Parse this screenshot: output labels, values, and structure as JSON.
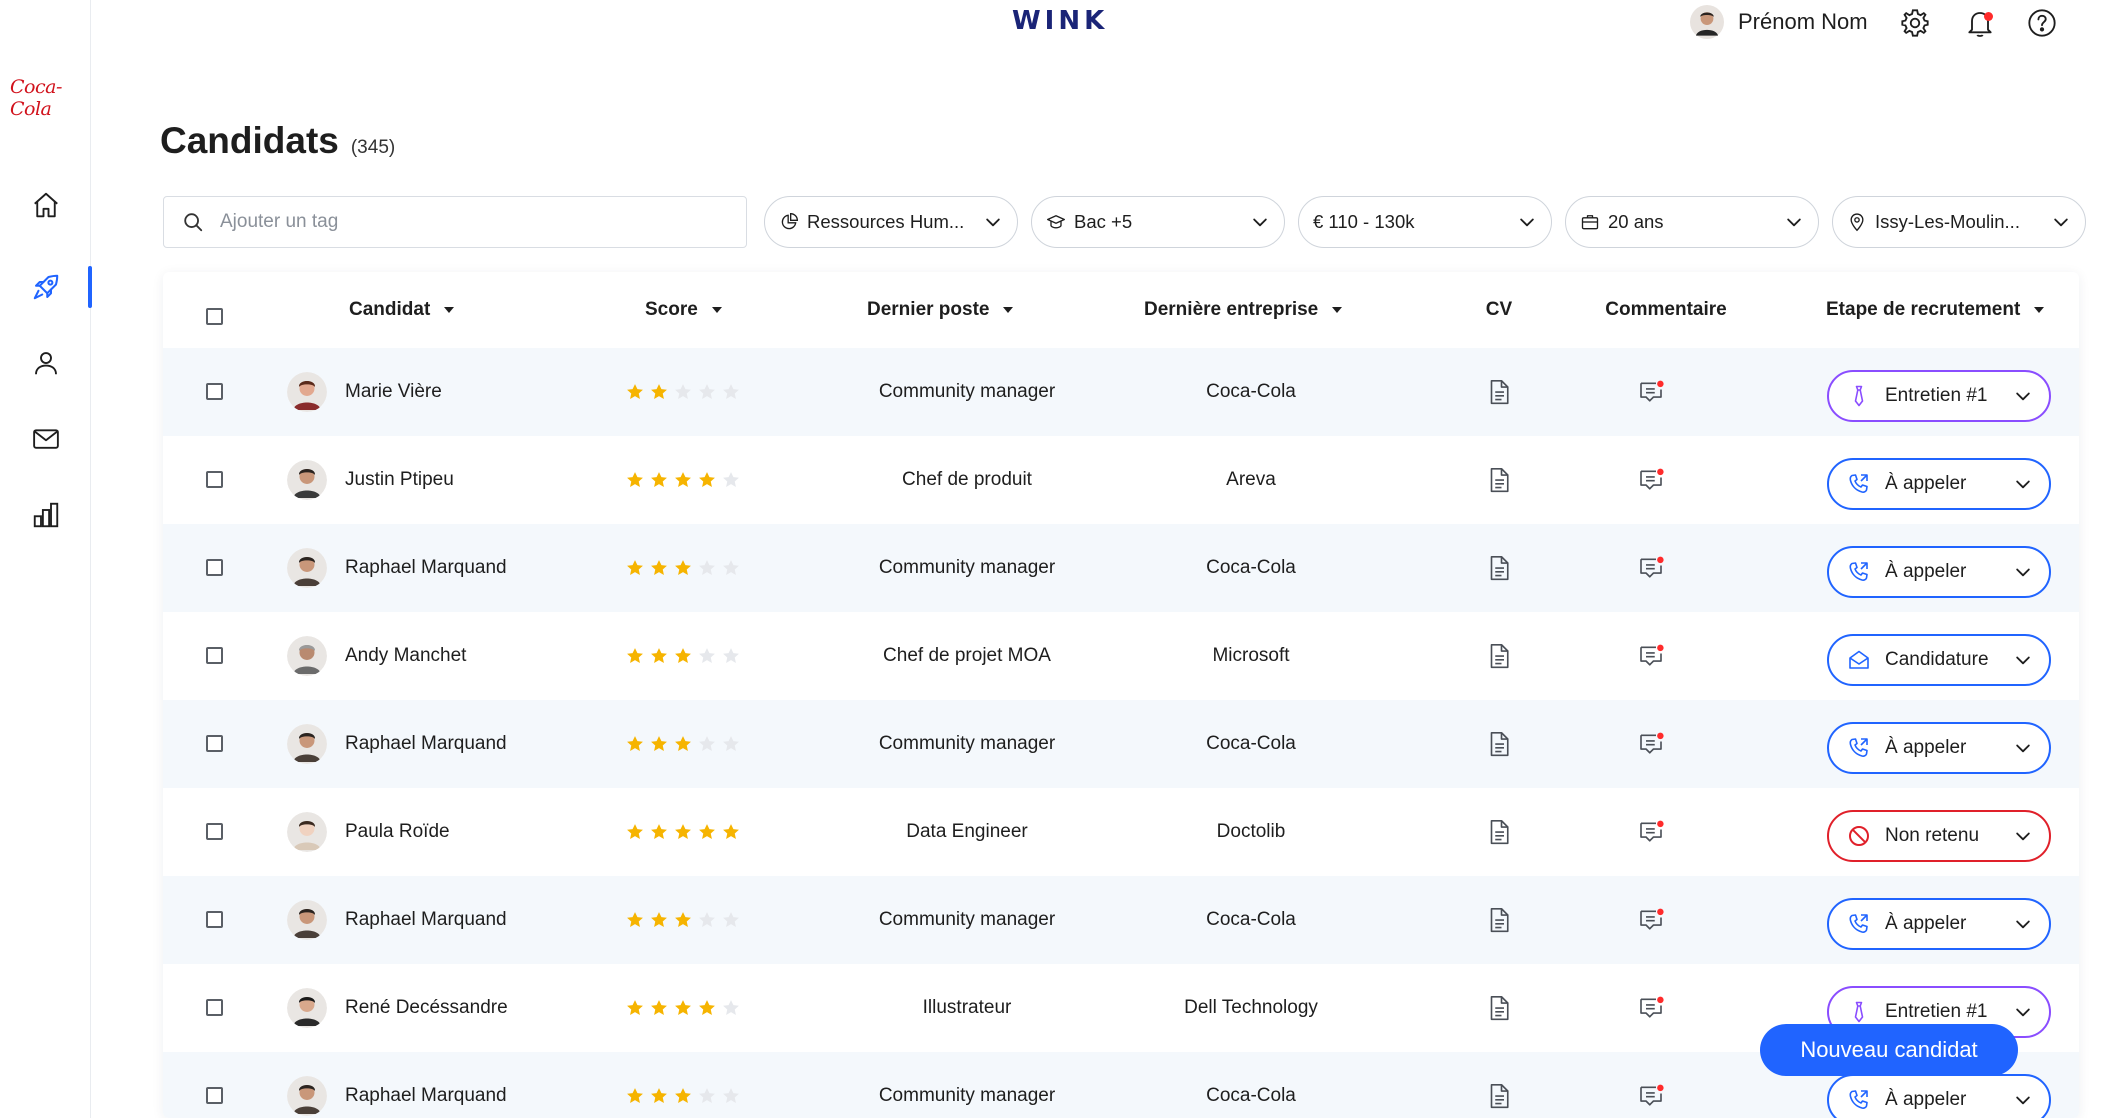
{
  "app": {
    "brand_logo": "Coca-Cola",
    "logo": "WINK"
  },
  "header": {
    "user_name": "Prénom Nom",
    "icons": [
      "settings-icon",
      "bell-icon",
      "help-icon"
    ]
  },
  "sidebar": {
    "items": [
      {
        "name": "home",
        "icon": "home-icon",
        "active": false
      },
      {
        "name": "candidats",
        "icon": "rocket-icon",
        "active": true
      },
      {
        "name": "profile",
        "icon": "user-icon",
        "active": false
      },
      {
        "name": "messages",
        "icon": "mail-icon",
        "active": false
      },
      {
        "name": "stats",
        "icon": "bar-chart-icon",
        "active": false
      }
    ]
  },
  "page": {
    "title": "Candidats",
    "count": "(345)"
  },
  "search": {
    "placeholder": "Ajouter un tag"
  },
  "filters": [
    {
      "icon": "pie-chart-icon",
      "label": "Ressources Hum..."
    },
    {
      "icon": "graduation-cap-icon",
      "label": "Bac +5"
    },
    {
      "icon": "euro-icon",
      "label": "€  110 - 130k"
    },
    {
      "icon": "briefcase-icon",
      "label": "20 ans"
    },
    {
      "icon": "location-pin-icon",
      "label": "Issy-Les-Moulin..."
    }
  ],
  "table": {
    "headers": {
      "candidat": "Candidat",
      "score": "Score",
      "dernier_poste": "Dernier poste",
      "derniere_entreprise": "Dernière entreprise",
      "cv": "CV",
      "commentaire": "Commentaire",
      "etape": "Etape de recrutement"
    },
    "rows": [
      {
        "name": "Marie Vière",
        "score": 2,
        "poste": "Community manager",
        "entreprise": "Coca-Cola",
        "stage": "Entretien #1"
      },
      {
        "name": "Justin Ptipeu",
        "score": 4,
        "poste": "Chef de produit",
        "entreprise": "Areva",
        "stage": "À appeler"
      },
      {
        "name": "Raphael Marquand",
        "score": 3,
        "poste": "Community manager",
        "entreprise": "Coca-Cola",
        "stage": "À appeler"
      },
      {
        "name": "Andy Manchet",
        "score": 3,
        "poste": "Chef de projet MOA",
        "entreprise": "Microsoft",
        "stage": "Candidature"
      },
      {
        "name": "Raphael Marquand",
        "score": 3,
        "poste": "Community manager",
        "entreprise": "Coca-Cola",
        "stage": "À appeler"
      },
      {
        "name": "Paula Roïde",
        "score": 5,
        "poste": "Data Engineer",
        "entreprise": "Doctolib",
        "stage": "Non retenu"
      },
      {
        "name": "Raphael Marquand",
        "score": 3,
        "poste": "Community manager",
        "entreprise": "Coca-Cola",
        "stage": "À appeler"
      },
      {
        "name": "René Decéssandre",
        "score": 4,
        "poste": "Illustrateur",
        "entreprise": "Dell Technology",
        "stage": "Entretien #1"
      },
      {
        "name": "Raphael Marquand",
        "score": 3,
        "poste": "Community manager",
        "entreprise": "Coca-Cola",
        "stage": "À appeler"
      }
    ],
    "max_score": 5
  },
  "stage_styles": {
    "Entretien #1": {
      "border": "#8a4dff",
      "icon": "tie-icon"
    },
    "À appeler": {
      "border": "#2064ff",
      "icon": "phone-icon"
    },
    "Candidature": {
      "border": "#2064ff",
      "icon": "envelope-icon"
    },
    "Non retenu": {
      "border": "#e0202a",
      "icon": "ban-icon"
    }
  },
  "colors": {
    "accent": "#2064ff",
    "star_on": "#f6b400",
    "star_off": "#e6e8ec",
    "row_alt": "#f4f8fc"
  },
  "fab": {
    "label": "Nouveau candidat"
  }
}
